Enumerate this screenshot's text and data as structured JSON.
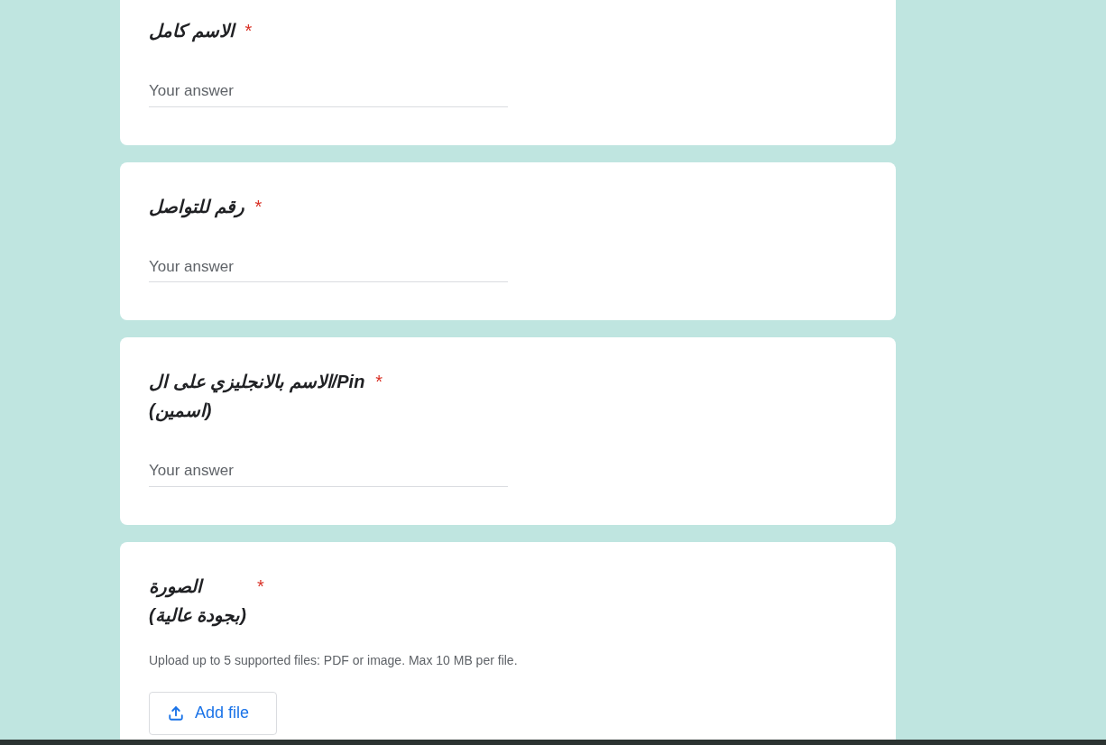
{
  "questions": [
    {
      "kind": "text",
      "title_lines": [
        "الاسم كامل"
      ],
      "required_mark": "*",
      "placeholder": "Your answer"
    },
    {
      "kind": "text",
      "title_lines": [
        "رقم للتواصل"
      ],
      "required_mark": "*",
      "placeholder": "Your answer"
    },
    {
      "kind": "text",
      "title_lines": [
        "Pin/الاسم بالانجليزي على ال",
        "(اسمين)"
      ],
      "required_mark": "*",
      "placeholder": "Your answer"
    },
    {
      "kind": "file",
      "title_lines": [
        "الصورة",
        "(بجودة عالية)"
      ],
      "required_mark": "*",
      "hint": "Upload up to 5 supported files: PDF or image. Max 10 MB per file.",
      "button": "Add file"
    }
  ]
}
